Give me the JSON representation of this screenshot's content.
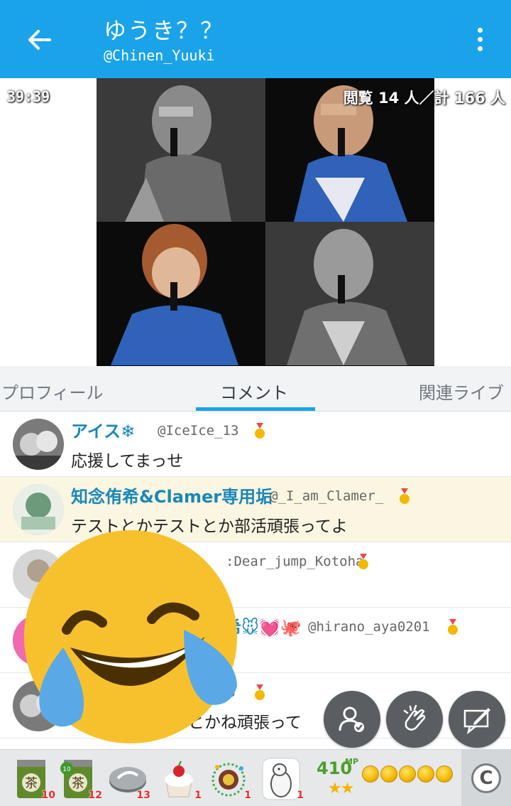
{
  "header": {
    "title": "ゆうき？？",
    "handle": "@Chinen_Yuuki"
  },
  "video": {
    "timer": "39:39",
    "viewers": "閲覧 14 人／計 166 人"
  },
  "tabs": [
    {
      "label": "プロフィール",
      "active": false
    },
    {
      "label": "コメント",
      "active": true
    },
    {
      "label": "関連ライブ",
      "active": false
    }
  ],
  "comments": [
    {
      "name": "アイス❄",
      "user": "@IceIce_13",
      "text": "応援してまっせ",
      "highlight": false
    },
    {
      "name": "知念侑希&Clamer専用垢",
      "user": "@_I_am_Clamer_",
      "text": "テストとかテストとか部活頑張ってよ",
      "highlight": true
    },
    {
      "name": "",
      "user": ":Dear_jump_Kotoha",
      "text": "",
      "highlight": false
    },
    {
      "name": "希🐭💓🐙",
      "user": "@hirano_aya0201",
      "text": "",
      "highlight": false
    },
    {
      "name": "",
      "user": "e_13",
      "text": "トとかね頑張って",
      "highlight": false
    }
  ],
  "gifts": [
    {
      "icon": "tea-can-icon",
      "count": "10"
    },
    {
      "icon": "tea-can-10-icon",
      "count": "12"
    },
    {
      "icon": "disc-icon",
      "count": "13"
    },
    {
      "icon": "cake-icon",
      "count": "1"
    },
    {
      "icon": "firework-icon",
      "count": "1"
    },
    {
      "icon": "bear-icon",
      "count": "1"
    }
  ],
  "points": {
    "mp_value": "410",
    "mp_unit": "MP",
    "stars": "★★",
    "coins_count": 5
  },
  "colors": {
    "brand": "#1aa3e8",
    "highlight_row": "#fbf6e1",
    "username": "#1a87b8"
  }
}
